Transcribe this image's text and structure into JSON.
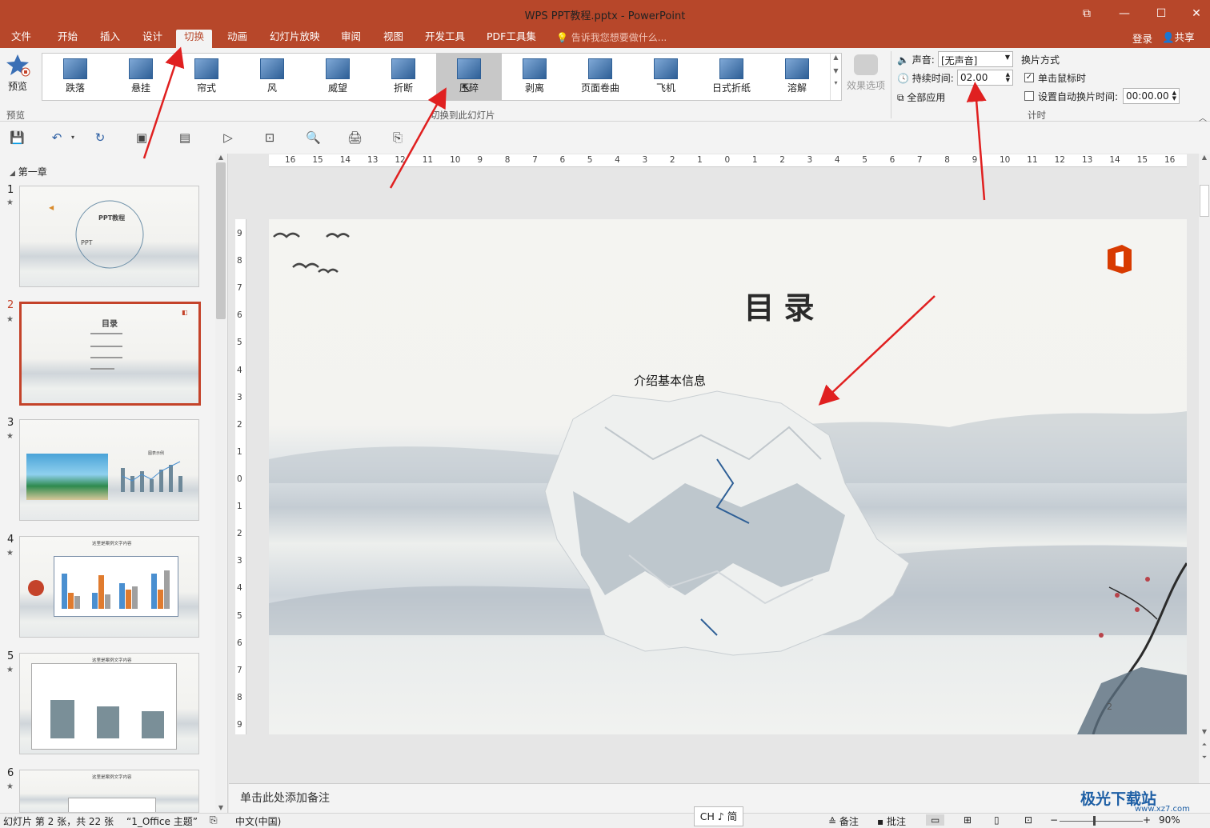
{
  "window": {
    "title": "WPS PPT教程.pptx - PowerPoint",
    "accent_color": "#b7472a",
    "controls": [
      "restore-ribbon-icon",
      "minimize-icon",
      "maximize-icon",
      "close-icon"
    ]
  },
  "tabs": [
    {
      "label": "文件"
    },
    {
      "label": "开始"
    },
    {
      "label": "插入"
    },
    {
      "label": "设计"
    },
    {
      "label": "切换",
      "active": true
    },
    {
      "label": "动画"
    },
    {
      "label": "幻灯片放映"
    },
    {
      "label": "审阅"
    },
    {
      "label": "视图"
    },
    {
      "label": "开发工具"
    },
    {
      "label": "PDF工具集"
    }
  ],
  "tell_me": "告诉我您想要做什么...",
  "account": {
    "login": "登录",
    "share": "共享"
  },
  "ribbon": {
    "preview_label": "预览",
    "preview_group": "预览",
    "transitions": [
      {
        "label": "跌落"
      },
      {
        "label": "悬挂"
      },
      {
        "label": "帘式"
      },
      {
        "label": "风"
      },
      {
        "label": "威望"
      },
      {
        "label": "折断"
      },
      {
        "label": "压碎",
        "selected": true
      },
      {
        "label": "剥离"
      },
      {
        "label": "页面卷曲"
      },
      {
        "label": "飞机"
      },
      {
        "label": "日式折纸"
      },
      {
        "label": "溶解"
      }
    ],
    "transition_group": "切换到此幻灯片",
    "effect_options": "效果选项",
    "sound_label": "声音:",
    "sound_value": "[无声音]",
    "duration_label": "持续时间:",
    "duration_value": "02.00",
    "apply_all": "全部应用",
    "advance_title": "换片方式",
    "on_click_label": "单击鼠标时",
    "on_click_checked": true,
    "auto_after_label": "设置自动换片时间:",
    "auto_after_checked": false,
    "auto_after_value": "00:00.00",
    "timing_group": "计时"
  },
  "slides_panel": {
    "section": "第一章",
    "slides": [
      {
        "num": "1",
        "title": "PPT教程",
        "sub": "PPT"
      },
      {
        "num": "2",
        "title": "目录",
        "selected": true
      },
      {
        "num": "3",
        "title": "图表示例"
      },
      {
        "num": "4",
        "title": "这里是案例文字内容"
      },
      {
        "num": "5",
        "title": "这里是案例文字内容"
      },
      {
        "num": "6",
        "title": "这里是案例文字内容"
      }
    ]
  },
  "ruler": {
    "h_ticks": [
      "16",
      "15",
      "14",
      "13",
      "12",
      "11",
      "10",
      "9",
      "8",
      "7",
      "6",
      "5",
      "4",
      "3",
      "2",
      "1",
      "0",
      "1",
      "2",
      "3",
      "4",
      "5",
      "6",
      "7",
      "8",
      "9",
      "10",
      "11",
      "12",
      "13",
      "14",
      "15",
      "16"
    ],
    "v_ticks": [
      "9",
      "8",
      "7",
      "6",
      "5",
      "4",
      "3",
      "2",
      "1",
      "0",
      "1",
      "2",
      "3",
      "4",
      "5",
      "6",
      "7",
      "8",
      "9"
    ]
  },
  "slide": {
    "title": "目录",
    "subtitle": "介绍基本信息",
    "page_number": "2"
  },
  "notes_placeholder": "单击此处添加备注",
  "status": {
    "slide_info": "幻灯片 第 2 张，共 22 张",
    "theme": "“1_Office 主题”",
    "language": "中文(中国)",
    "ime": "CH ♪ 简",
    "notes": "备注",
    "comments": "批注",
    "zoom": "90%"
  },
  "watermark": {
    "text": "极光下载站",
    "url": "www.xz7.com"
  }
}
